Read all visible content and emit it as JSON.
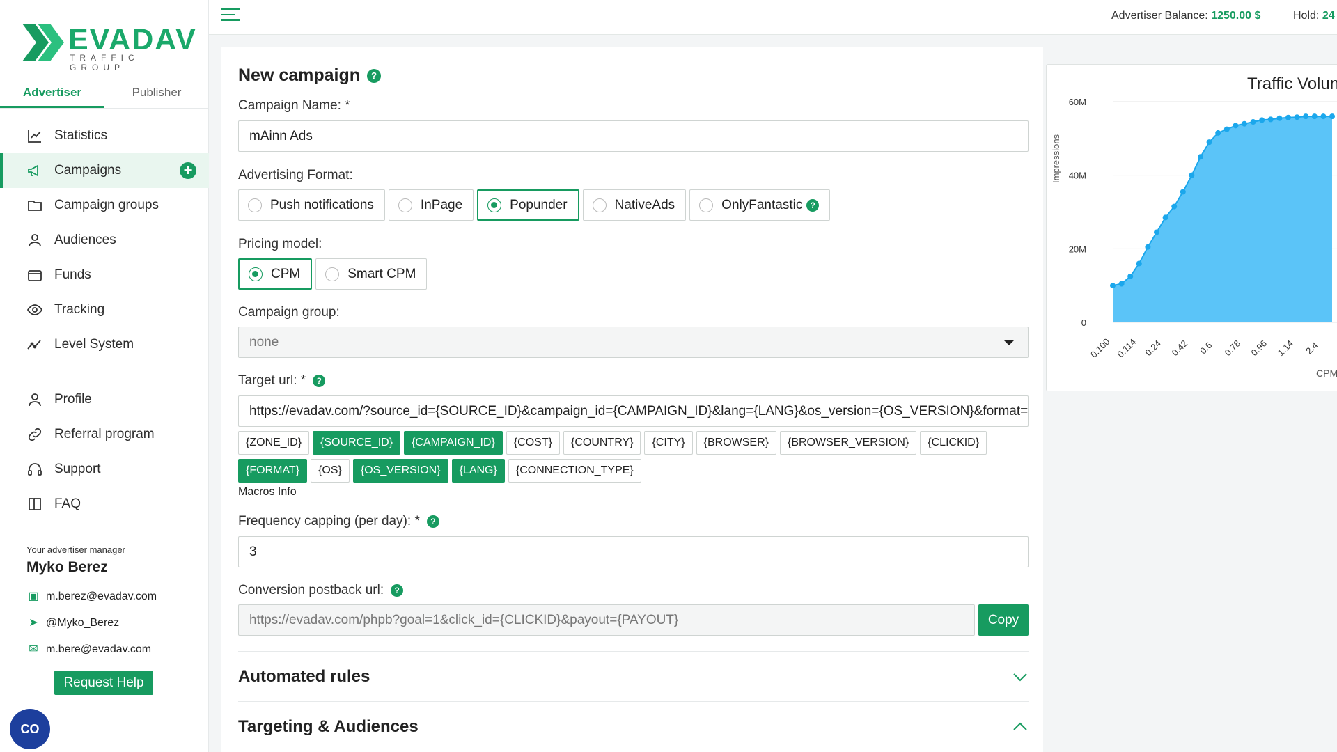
{
  "brand": {
    "name": "EVADAV",
    "subtitle": "TRAFFIC GROUP"
  },
  "role_tabs": [
    "Advertiser",
    "Publisher"
  ],
  "nav": [
    {
      "label": "Statistics",
      "icon": "chart-icon"
    },
    {
      "label": "Campaigns",
      "icon": "megaphone-icon",
      "active": true
    },
    {
      "label": "Campaign groups",
      "icon": "folder-icon"
    },
    {
      "label": "Audiences",
      "icon": "audience-icon"
    },
    {
      "label": "Funds",
      "icon": "wallet-icon"
    },
    {
      "label": "Tracking",
      "icon": "eye-icon"
    },
    {
      "label": "Level System",
      "icon": "level-icon"
    }
  ],
  "nav2": [
    {
      "label": "Profile",
      "icon": "user-icon"
    },
    {
      "label": "Referral program",
      "icon": "link-icon"
    },
    {
      "label": "Support",
      "icon": "headset-icon"
    },
    {
      "label": "FAQ",
      "icon": "book-icon"
    }
  ],
  "manager": {
    "caption": "Your advertiser manager",
    "name": "Myko Berez",
    "teams": "m.berez@evadav.com",
    "telegram": "@Myko_Berez",
    "email": "m.bere@evadav.com",
    "button": "Request Help"
  },
  "fab_label": "CO",
  "topbar": {
    "balance_label": "Advertiser Balance:",
    "balance_value": "1250.00 $",
    "hold_label": "Hold:",
    "hold_value": "24"
  },
  "form": {
    "title": "New campaign",
    "help": "?",
    "name_label": "Campaign Name: *",
    "name_value": "mAinn Ads",
    "format_label": "Advertising Format:",
    "formats": [
      "Push notifications",
      "InPage",
      "Popunder",
      "NativeAds",
      "OnlyFantastic"
    ],
    "format_selected": "Popunder",
    "pricing_label": "Pricing model:",
    "pricing": [
      "CPM",
      "Smart CPM"
    ],
    "pricing_selected": "CPM",
    "group_label": "Campaign group:",
    "group_value": "none",
    "target_label": "Target url: *",
    "target_value": "https://evadav.com/?source_id={SOURCE_ID}&campaign_id={CAMPAIGN_ID}&lang={LANG}&os_version={OS_VERSION}&format={FORMAT}",
    "macros": [
      {
        "label": "{ZONE_ID}",
        "on": false
      },
      {
        "label": "{SOURCE_ID}",
        "on": true
      },
      {
        "label": "{CAMPAIGN_ID}",
        "on": true
      },
      {
        "label": "{COST}",
        "on": false
      },
      {
        "label": "{COUNTRY}",
        "on": false
      },
      {
        "label": "{CITY}",
        "on": false
      },
      {
        "label": "{BROWSER}",
        "on": false
      },
      {
        "label": "{BROWSER_VERSION}",
        "on": false
      },
      {
        "label": "{CLICKID}",
        "on": false
      },
      {
        "label": "{FORMAT}",
        "on": true
      },
      {
        "label": "{OS}",
        "on": false
      },
      {
        "label": "{OS_VERSION}",
        "on": true
      },
      {
        "label": "{LANG}",
        "on": true
      },
      {
        "label": "{CONNECTION_TYPE}",
        "on": false
      }
    ],
    "macros_link": "Macros Info",
    "freq_label": "Frequency capping (per day): *",
    "freq_value": "3",
    "postback_label": "Conversion postback url:",
    "postback_value": "https://evadav.com/phpb?goal=1&click_id={CLICKID}&payout={PAYOUT}",
    "copy_label": "Copy",
    "sections": [
      "Automated rules",
      "Targeting & Audiences"
    ]
  },
  "chart_data": {
    "type": "area",
    "title": "Traffic Volun",
    "ylabel": "Impressions",
    "xlabel": "CPM",
    "y_ticks": [
      "60M",
      "40M",
      "20M",
      "0"
    ],
    "x_ticks": [
      "0.100",
      "0.114",
      "0.24",
      "0.42",
      "0.6",
      "0.78",
      "0.96",
      "1.14",
      "2.4"
    ],
    "ylim": [
      0,
      60000000
    ],
    "values": [
      10000000,
      10500000,
      12500000,
      16000000,
      20500000,
      24500000,
      28500000,
      31500000,
      35500000,
      40000000,
      45000000,
      49000000,
      51500000,
      52500000,
      53500000,
      54000000,
      54500000,
      55000000,
      55200000,
      55500000,
      55700000,
      55800000,
      56000000,
      56000000,
      56000000,
      56000000
    ],
    "fill": "#5bc4f8",
    "stroke": "#1ba7ec"
  }
}
